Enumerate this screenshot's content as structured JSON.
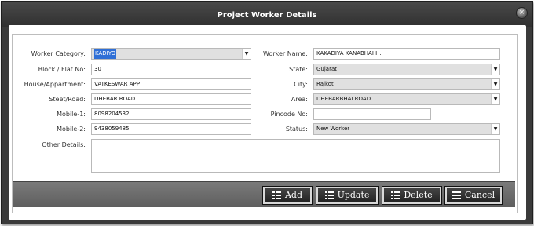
{
  "dialog": {
    "title": "Project Worker Details",
    "close_glyph": "×"
  },
  "form": {
    "worker_category": {
      "label": "Worker Category:",
      "value": "KADIYO"
    },
    "block_flat_no": {
      "label": "Block / Flat No:",
      "value": "30"
    },
    "house_appartment": {
      "label": "House/Appartment:",
      "value": "VATKESWAR APP"
    },
    "steet_road": {
      "label": "Steet/Road:",
      "value": "DHEBAR ROAD"
    },
    "mobile_1": {
      "label": "Mobile-1:",
      "value": "8098204532"
    },
    "mobile_2": {
      "label": "Mobile-2:",
      "value": "9438059485"
    },
    "other_details": {
      "label": "Other Details:",
      "value": ""
    },
    "worker_name": {
      "label": "Worker Name:",
      "value": "KAKADIYA KANABHAI H."
    },
    "state": {
      "label": "State:",
      "value": "Gujarat"
    },
    "city": {
      "label": "City:",
      "value": "Rajkot"
    },
    "area": {
      "label": "Area:",
      "value": "DHEBARBHAI ROAD"
    },
    "pincode_no": {
      "label": "Pincode No:",
      "value": ""
    },
    "status": {
      "label": "Status:",
      "value": "New Worker"
    }
  },
  "buttons": {
    "add": "Add",
    "update": "Update",
    "delete": "Delete",
    "cancel": "Cancel"
  },
  "colors": {
    "frame": "#3a3a3a",
    "footer": "#6a6a6a",
    "selection": "#2f6fd6"
  },
  "icons": {
    "close": "close-icon",
    "button": "list-icon"
  }
}
